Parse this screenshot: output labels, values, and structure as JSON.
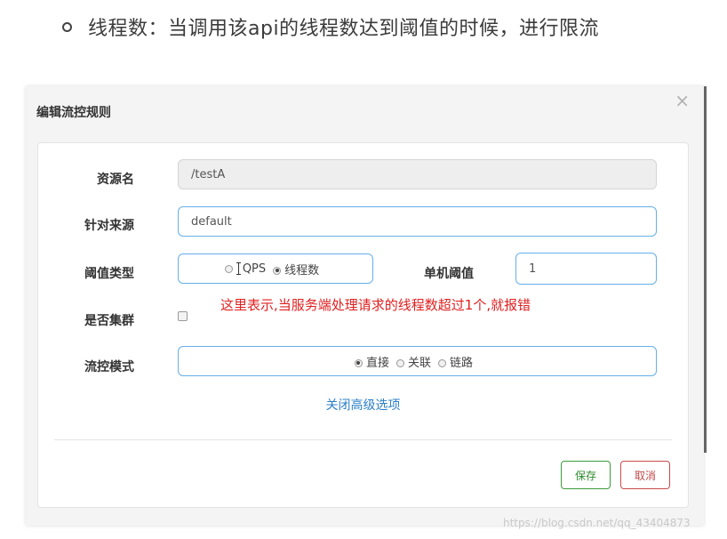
{
  "heading_text": "线程数：当调用该api的线程数达到阈值的时候，进行限流",
  "modal": {
    "title": "编辑流控规则",
    "close_glyph": "×",
    "resource": {
      "label": "资源名",
      "value": "/testA"
    },
    "source": {
      "label": "针对来源",
      "value": "default"
    },
    "threshold_type": {
      "label": "阈值类型",
      "options": [
        "QPS",
        "线程数"
      ],
      "selected": "线程数"
    },
    "single_threshold": {
      "label": "单机阈值",
      "value": "1"
    },
    "cluster": {
      "label": "是否集群",
      "checked": false
    },
    "flow_mode": {
      "label": "流控模式",
      "options": [
        "直接",
        "关联",
        "链路"
      ],
      "selected": "直接"
    },
    "advanced_link": "关闭高级选项",
    "save_label": "保存",
    "cancel_label": "取消"
  },
  "annotation": "这里表示,当服务端处理请求的线程数超过1个,就报错",
  "watermark": "https://blog.csdn.net/qq_43404873",
  "colors": {
    "input_border": "#66afe9",
    "annotation_red": "#e02020",
    "link_blue": "#2c7fc8",
    "save_green": "#3c9b3c",
    "cancel_red": "#c94a4a"
  }
}
